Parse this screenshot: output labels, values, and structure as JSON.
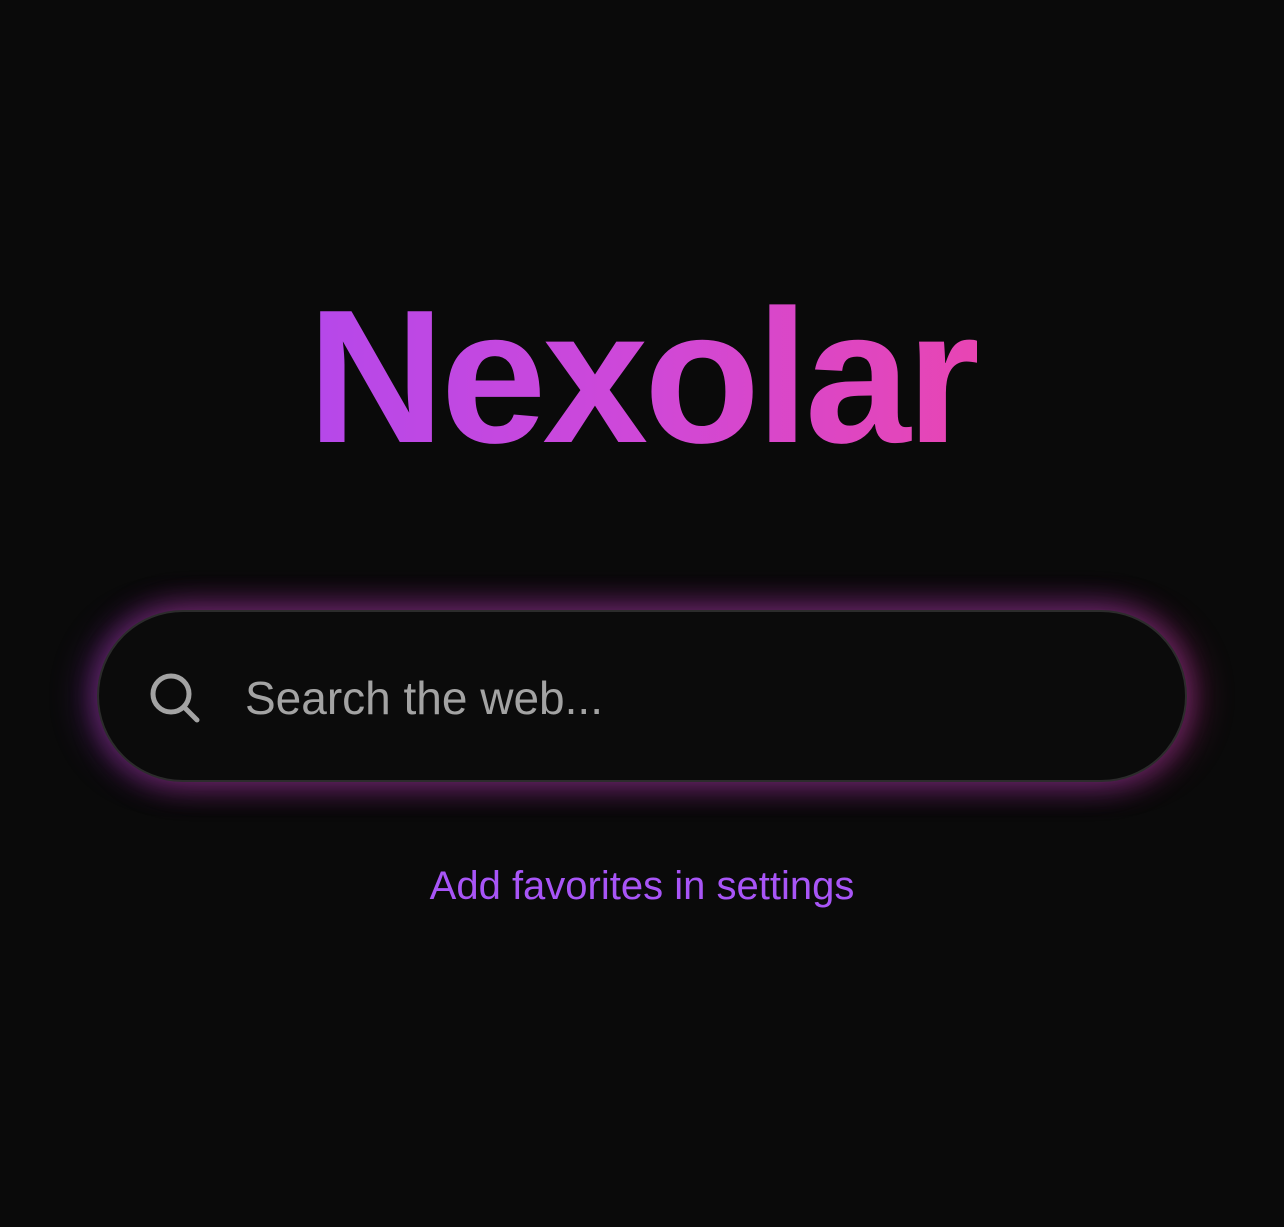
{
  "brand": {
    "name": "Nexolar",
    "gradient_start": "#b548ea",
    "gradient_end": "#e845b3"
  },
  "search": {
    "placeholder": "Search the web...",
    "value": "",
    "icon": "search-icon"
  },
  "footer": {
    "favorites_link": "Add favorites in settings",
    "link_color": "#a855f7"
  },
  "colors": {
    "background": "#0a0a0a",
    "search_border": "#2c2c2c",
    "placeholder": "#a3a3a3"
  }
}
